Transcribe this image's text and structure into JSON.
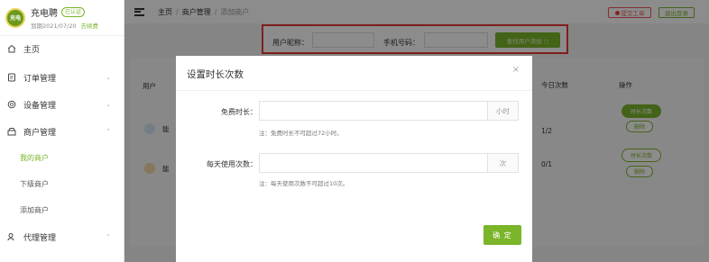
{
  "brand": {
    "name": "充电聘",
    "tag": "已认证",
    "expiry": "到期2021/07/20",
    "renew": "去续费"
  },
  "nav": {
    "home": "主页",
    "items": [
      {
        "label": "订单管理",
        "chevron": "⌄",
        "icon": "order-icon"
      },
      {
        "label": "设备管理",
        "chevron": "⌄",
        "icon": "device-icon"
      },
      {
        "label": "商户管理",
        "chevron": "⌃",
        "icon": "merchant-icon"
      }
    ],
    "sub_items": [
      "我的商户",
      "下级商户",
      "添加商户"
    ],
    "agent": {
      "label": "代理管理",
      "chevron": "⌃"
    }
  },
  "breadcrumb": {
    "home": "主页",
    "sep1": "/",
    "middle": "商户管理",
    "sep2": "/",
    "current": "添加商户"
  },
  "header": {
    "ticket_button": "提交工单",
    "logout_button": "退出登录"
  },
  "search": {
    "nickname_label": "用户昵称：",
    "phone_label": "手机号码：",
    "nickname_value": "",
    "phone_value": "",
    "submit_label": "查找用户添加 ○"
  },
  "background_table": {
    "col_user": "用户",
    "col_today": "今日次数",
    "col_action": "操作",
    "rows": [
      {
        "name_prefix": "能",
        "today": "1/2",
        "btn_primary": "时长次数",
        "btn_delete": "删除"
      },
      {
        "name_prefix": "能",
        "today": "0/1",
        "btn_primary": "时长次数",
        "btn_delete": "删除"
      }
    ]
  },
  "modal": {
    "title": "设置时长次数",
    "close": "×",
    "fields": [
      {
        "label": "免费时长：",
        "value": "",
        "unit": "小时",
        "note": "注：免费时长不可超过72小时。"
      },
      {
        "label": "每天使用次数：",
        "value": "",
        "unit": "次",
        "note": "注：每天使用次数不可超过10次。"
      }
    ],
    "confirm": "确 定"
  },
  "colors": {
    "accent": "#7ab52a",
    "highlight_border": "#e53935",
    "overlay": "rgba(0,0,0,0.45)"
  }
}
